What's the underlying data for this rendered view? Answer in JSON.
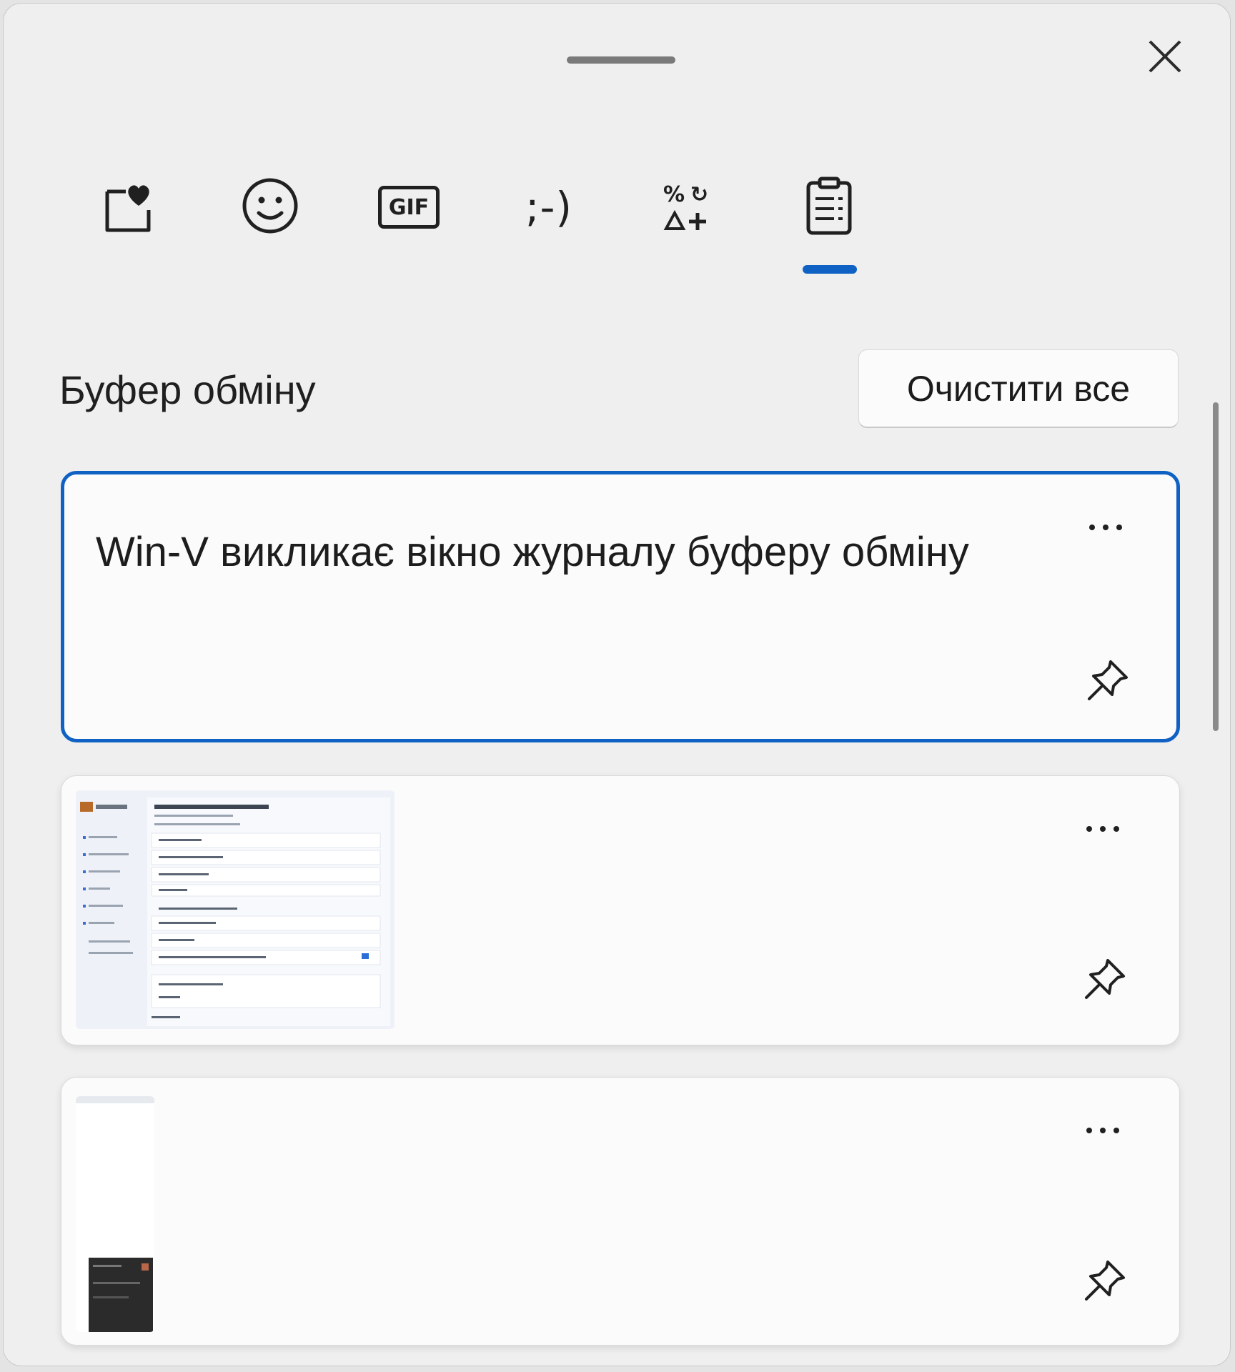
{
  "window": {
    "close_icon": "close-icon",
    "grabber": "drag-handle"
  },
  "tabs": [
    {
      "name": "favorites",
      "icon": "heart-clipboard-icon"
    },
    {
      "name": "emoji",
      "icon": "smiley-icon"
    },
    {
      "name": "gif",
      "icon": "gif-icon",
      "label": "GIF"
    },
    {
      "name": "kaomoji",
      "icon": "kaomoji-icon",
      "label": ";-)"
    },
    {
      "name": "symbols",
      "icon": "symbols-icon"
    },
    {
      "name": "clipboard",
      "icon": "clipboard-icon",
      "selected": true
    }
  ],
  "clipboard": {
    "title": "Буфер обміну",
    "clear_all_label": "Очистити все",
    "items": [
      {
        "type": "text",
        "text": "Win-V викликає вікно журналу буферу обміну",
        "selected": true
      },
      {
        "type": "image",
        "description": "screenshot-thumbnail"
      },
      {
        "type": "image",
        "description": "screenshot-thumbnail"
      }
    ]
  },
  "colors": {
    "accent": "#0f62c4",
    "panel_bg": "#efefef",
    "card_bg": "#fbfbfb"
  }
}
